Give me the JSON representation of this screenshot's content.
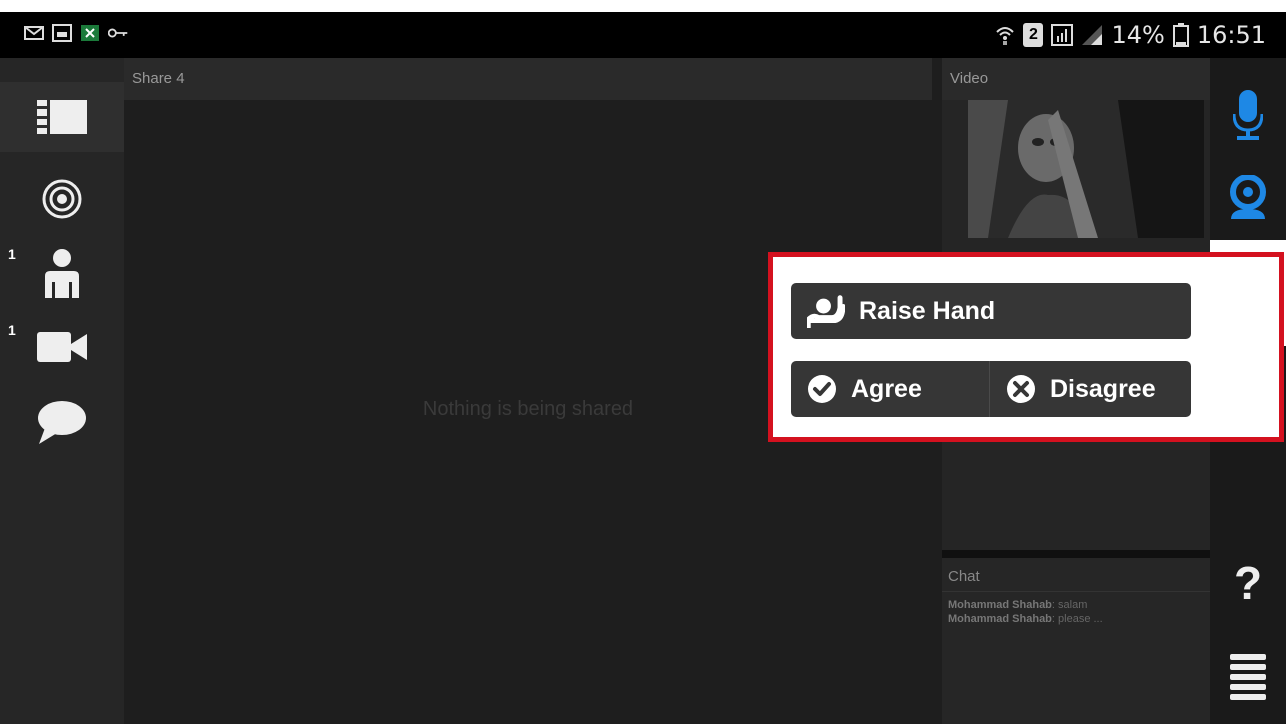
{
  "status_bar": {
    "battery": "14%",
    "time": "16:51",
    "sim_slot": "2"
  },
  "left_sidebar": {
    "items": [
      {
        "icon": "layout-icon",
        "badge": ""
      },
      {
        "icon": "target-icon",
        "badge": ""
      },
      {
        "icon": "user-icon",
        "badge": "1"
      },
      {
        "icon": "camera-icon",
        "badge": "1"
      },
      {
        "icon": "chat-bubble-icon",
        "badge": ""
      }
    ]
  },
  "share_panel": {
    "title": "Share 4",
    "empty_message": "Nothing is being shared"
  },
  "video_panel": {
    "title": "Video"
  },
  "chat_panel": {
    "title": "Chat",
    "messages": [
      {
        "sender": "Mohammad Shahab",
        "text": ": salam"
      },
      {
        "sender": "Mohammad Shahab",
        "text": ": please ..."
      }
    ]
  },
  "popup": {
    "raise_hand_label": "Raise Hand",
    "agree_label": "Agree",
    "disagree_label": "Disagree"
  },
  "right_bar": {
    "help_label": "?",
    "items": [
      "microphone-icon",
      "webcam-icon",
      "raise-hand-icon",
      "help-icon",
      "menu-icon"
    ]
  },
  "colors": {
    "accent_blue": "#1e88e5",
    "highlight_red": "#d4111f",
    "panel_dark": "#1e1e1e"
  }
}
